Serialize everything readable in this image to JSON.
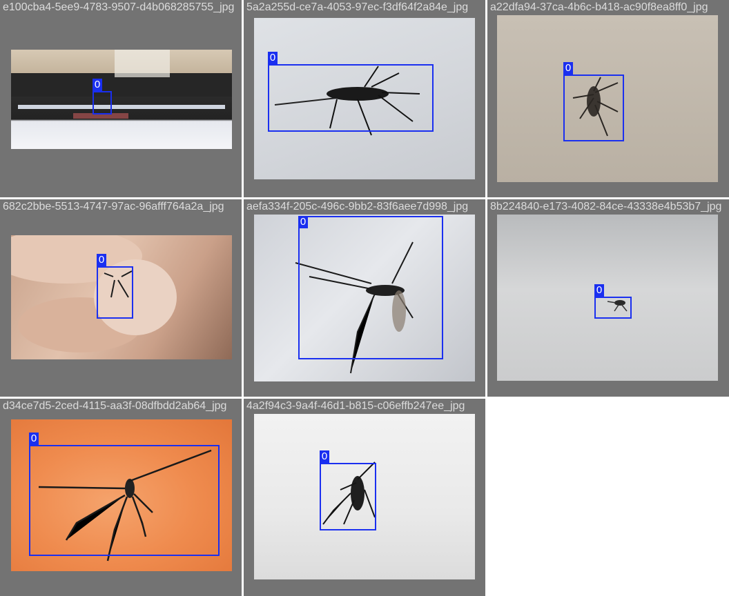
{
  "grid": {
    "cells": [
      {
        "filename": "e100cba4-5ee9-4783-9507-d4b068285755_jpg",
        "class_label": "0"
      },
      {
        "filename": "5a2a255d-ce7a-4053-97ec-f3df64f2a84e_jpg",
        "class_label": "0"
      },
      {
        "filename": "a22dfa94-37ca-4b6c-b418-ac90f8ea8ff0_jpg",
        "class_label": "0"
      },
      {
        "filename": "682c2bbe-5513-4747-97ac-96afff764a2a_jpg",
        "class_label": "0"
      },
      {
        "filename": "aefa334f-205c-496c-9bb2-83f6aee7d998_jpg",
        "class_label": "0"
      },
      {
        "filename": "8b224840-e173-4082-84ce-43338e4b53b7_jpg",
        "class_label": "0"
      },
      {
        "filename": "d34ce7d5-2ced-4115-aa3f-08dfbdd2ab64_jpg",
        "class_label": "0"
      },
      {
        "filename": "4a2f94c3-9a4f-46d1-b815-c06effb247ee_jpg",
        "class_label": "0"
      }
    ]
  },
  "colors": {
    "bbox": "#1a2ff0",
    "cell_background": "#737373",
    "filename_text": "#dcdcdc"
  }
}
